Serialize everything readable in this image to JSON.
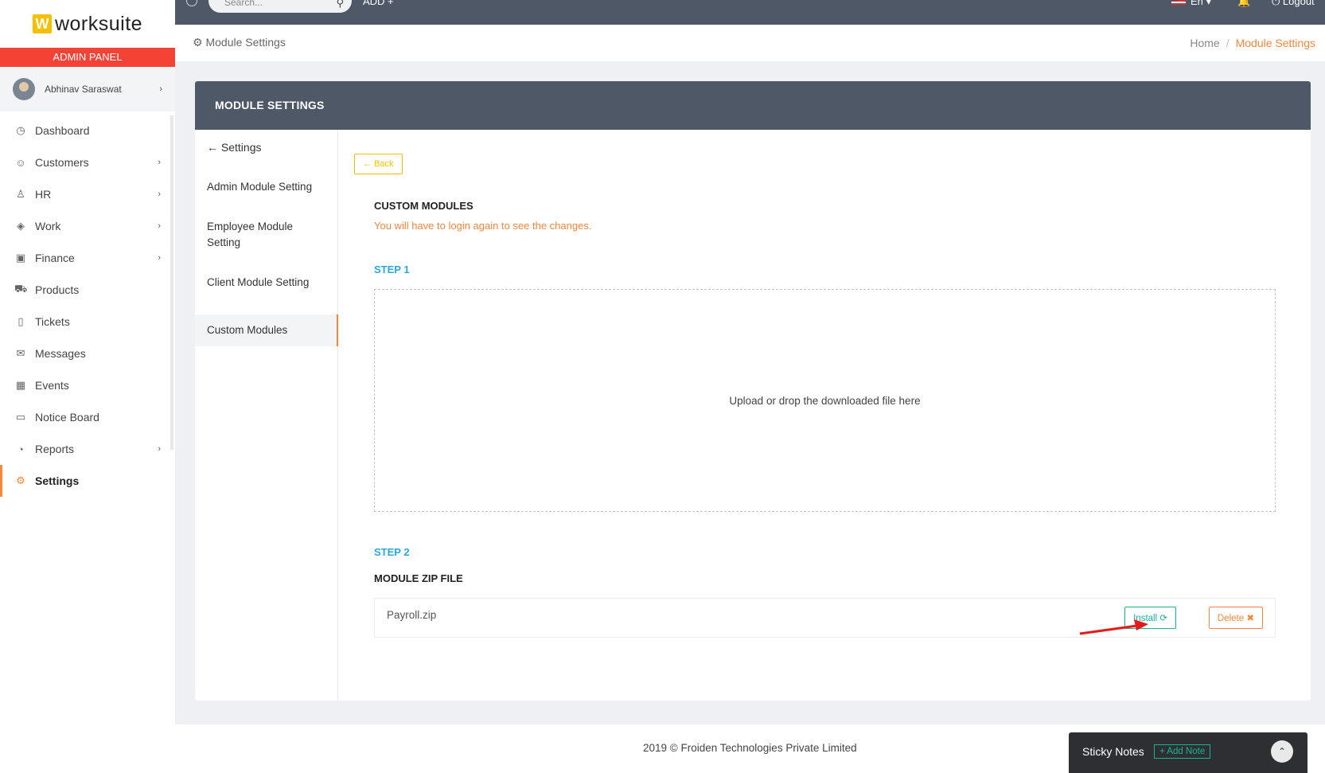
{
  "app": {
    "logo_mark": "W",
    "logo_text": "worksuite",
    "admin_panel": "ADMIN PANEL",
    "user_name": "Abhinav Saraswat"
  },
  "topbar": {
    "search_placeholder": "Search...",
    "add_label": "ADD +",
    "language": "En ▾",
    "logout_label": "⏻ Logout"
  },
  "sidebar": {
    "items": [
      {
        "label": "Dashboard",
        "icon": "dashboard-icon",
        "glyph": "◷",
        "chevron": ""
      },
      {
        "label": "Customers",
        "icon": "customers-icon",
        "glyph": "☺",
        "chevron": "›"
      },
      {
        "label": "HR",
        "icon": "hr-icon",
        "glyph": "♙",
        "chevron": "›"
      },
      {
        "label": "Work",
        "icon": "work-icon",
        "glyph": "◈",
        "chevron": "›"
      },
      {
        "label": "Finance",
        "icon": "finance-icon",
        "glyph": "▣",
        "chevron": "›"
      },
      {
        "label": "Products",
        "icon": "products-icon",
        "glyph": "⛟",
        "chevron": ""
      },
      {
        "label": "Tickets",
        "icon": "tickets-icon",
        "glyph": "▯",
        "chevron": ""
      },
      {
        "label": "Messages",
        "icon": "messages-icon",
        "glyph": "✉",
        "chevron": ""
      },
      {
        "label": "Events",
        "icon": "events-icon",
        "glyph": "▦",
        "chevron": ""
      },
      {
        "label": "Notice Board",
        "icon": "notice-board-icon",
        "glyph": "▭",
        "chevron": ""
      },
      {
        "label": "Reports",
        "icon": "reports-icon",
        "glyph": "◔",
        "chevron": "›"
      },
      {
        "label": "Settings",
        "icon": "settings-icon",
        "glyph": "⚙",
        "chevron": ""
      }
    ]
  },
  "header": {
    "page_title": "Module Settings",
    "breadcrumb_home": "Home",
    "breadcrumb_current": "Module Settings"
  },
  "card": {
    "title": "MODULE SETTINGS",
    "menu": {
      "back_label": "Settings",
      "admin": "Admin Module Setting",
      "employee": "Employee Module Setting",
      "client": "Client Module Setting",
      "custom": "Custom Modules"
    },
    "back_button": "Back",
    "custom_title": "CUSTOM MODULES",
    "warning": "You will have to login again to see the changes.",
    "step1": "STEP 1",
    "dropzone_text": "Upload or drop the downloaded file here",
    "step2": "STEP 2",
    "module_zip_title": "MODULE ZIP FILE",
    "file_name": "Payroll.zip",
    "install_label": "Install",
    "delete_label": "Delete"
  },
  "footer": {
    "copyright": "2019 © Froiden Technologies Private Limited",
    "sticky_title": "Sticky Notes",
    "add_note": "+ Add Note"
  },
  "colors": {
    "sidebar_active": "#f5863c",
    "admin_banner": "#f44336",
    "topbar": "#4f5867",
    "step_blue": "#29a8e0",
    "install_green": "#1ab394",
    "back_yellow": "#f6c000",
    "annotation_arrow": "#e21b1b"
  }
}
